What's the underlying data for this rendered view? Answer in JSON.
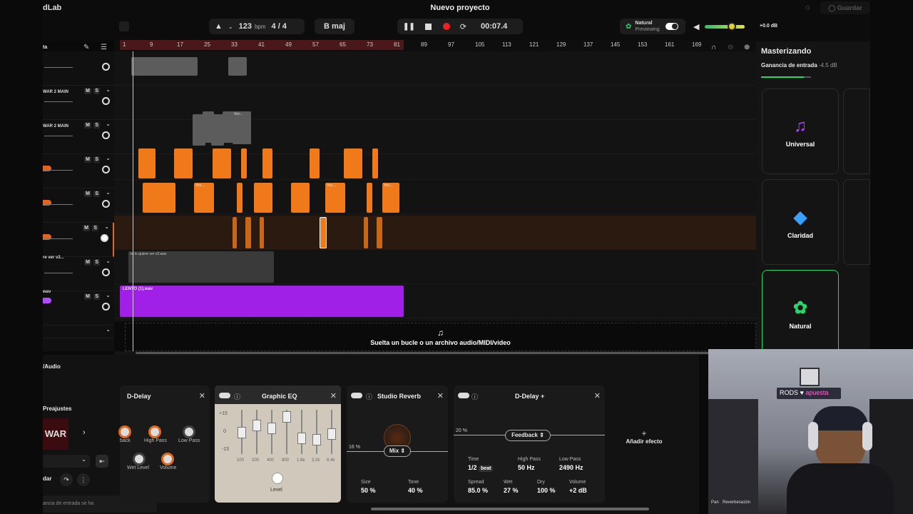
{
  "app": {
    "brand": "dLab",
    "project_title": "Nuevo proyecto",
    "save_label": "Guardar"
  },
  "toolbar": {
    "bpm_value": "123",
    "bpm_unit": "bpm",
    "time_signature": "4 / 4",
    "key": "B maj",
    "time": "00:07.4"
  },
  "preset_mode": {
    "name": "Natural",
    "status": "Previewing",
    "volume_db": "+0.0 dB"
  },
  "ruler": {
    "marks": [
      "1",
      "9",
      "17",
      "25",
      "33",
      "41",
      "49",
      "57",
      "65",
      "73",
      "81",
      "89",
      "97",
      "105",
      "113",
      "121",
      "129",
      "137",
      "145",
      "153",
      "161",
      "169"
    ]
  },
  "tracks": [
    {
      "name": "ta"
    },
    {
      "name": "WAR 2 MAIN"
    },
    {
      "name": "WAR 2 MAIN"
    },
    {
      "name": ""
    },
    {
      "name": ""
    },
    {
      "name": ""
    },
    {
      "name": "re ver v2..."
    },
    {
      "name": "wav"
    }
  ],
  "clips": {
    "vocal": "no lo quiere ver v2.wav",
    "lento": "LENTO (1).wav",
    "var": "Voc..."
  },
  "track_controls": {
    "mute": "M",
    "solo": "S"
  },
  "drop_zone": {
    "label": "Suelta un bucle o un archivo audio/MIDI/video"
  },
  "mastering": {
    "title": "Masterizando",
    "input_gain_label": "Ganancia de entrada",
    "input_gain_value": "-4.5 dB",
    "input_gain_level": 0.85,
    "presets": [
      {
        "name": "Universal",
        "icon": "music-note-icon",
        "color": "#b044ff"
      },
      {
        "name": "Claridad",
        "icon": "diamond-icon",
        "color": "#3aa0ff"
      },
      {
        "name": "Natural",
        "icon": "lotus-icon",
        "color": "#2fd36b"
      }
    ]
  },
  "bottom": {
    "section_title": "/Audio",
    "presets_label": "Preajustes",
    "preset_art": "WAR",
    "save_short": "dar",
    "gain_hint": "ancia de entrada se ha"
  },
  "effects": [
    {
      "name": "D-Delay",
      "params": [
        "back",
        "High Pass",
        "Low Pass",
        "Wet Level",
        "Volume"
      ]
    },
    {
      "name": "Graphic EQ",
      "scale": [
        "+15",
        "0",
        "-15"
      ],
      "bands": [
        "100",
        "200",
        "400",
        "800",
        "1.6k",
        "3.2k",
        "6.4k"
      ],
      "level_label": "Level"
    },
    {
      "name": "Studio Reverb",
      "percent": "16 %",
      "mix_label": "Mix",
      "size_label": "Size",
      "size_value": "50 %",
      "tone_label": "Tone",
      "tone_value": "40 %"
    },
    {
      "name": "D-Delay +",
      "percent": "20 %",
      "feedback_label": "Feedback",
      "time_label": "Time",
      "time_value": "1/2",
      "time_unit": "beat",
      "highpass_label": "High Pass",
      "highpass_value": "50 Hz",
      "lowpass_label": "Low Pass",
      "lowpass_value": "2490 Hz",
      "spread_label": "Spread",
      "spread_value": "85.0 %",
      "wet_label": "Wet",
      "wet_value": "27 %",
      "dry_label": "Dry",
      "dry_value": "100 %",
      "volume_label": "Volume",
      "volume_value": "+2 dB"
    }
  ],
  "add_effect": {
    "label": "Añadir efecto"
  },
  "webcam": {
    "sign_text": "RODS",
    "sign_text2": "apuesta",
    "bottom_label": "Reverberación",
    "bottom_left": "Pan"
  }
}
